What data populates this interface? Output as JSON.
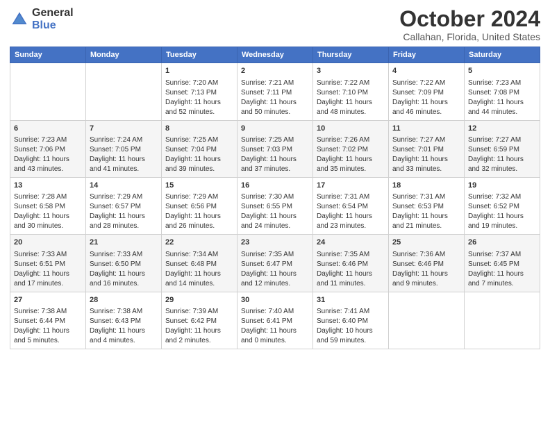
{
  "logo": {
    "general": "General",
    "blue": "Blue"
  },
  "title": "October 2024",
  "location": "Callahan, Florida, United States",
  "headers": [
    "Sunday",
    "Monday",
    "Tuesday",
    "Wednesday",
    "Thursday",
    "Friday",
    "Saturday"
  ],
  "weeks": [
    [
      {
        "day": "",
        "sunrise": "",
        "sunset": "",
        "daylight": ""
      },
      {
        "day": "",
        "sunrise": "",
        "sunset": "",
        "daylight": ""
      },
      {
        "day": "1",
        "sunrise": "Sunrise: 7:20 AM",
        "sunset": "Sunset: 7:13 PM",
        "daylight": "Daylight: 11 hours and 52 minutes."
      },
      {
        "day": "2",
        "sunrise": "Sunrise: 7:21 AM",
        "sunset": "Sunset: 7:11 PM",
        "daylight": "Daylight: 11 hours and 50 minutes."
      },
      {
        "day": "3",
        "sunrise": "Sunrise: 7:22 AM",
        "sunset": "Sunset: 7:10 PM",
        "daylight": "Daylight: 11 hours and 48 minutes."
      },
      {
        "day": "4",
        "sunrise": "Sunrise: 7:22 AM",
        "sunset": "Sunset: 7:09 PM",
        "daylight": "Daylight: 11 hours and 46 minutes."
      },
      {
        "day": "5",
        "sunrise": "Sunrise: 7:23 AM",
        "sunset": "Sunset: 7:08 PM",
        "daylight": "Daylight: 11 hours and 44 minutes."
      }
    ],
    [
      {
        "day": "6",
        "sunrise": "Sunrise: 7:23 AM",
        "sunset": "Sunset: 7:06 PM",
        "daylight": "Daylight: 11 hours and 43 minutes."
      },
      {
        "day": "7",
        "sunrise": "Sunrise: 7:24 AM",
        "sunset": "Sunset: 7:05 PM",
        "daylight": "Daylight: 11 hours and 41 minutes."
      },
      {
        "day": "8",
        "sunrise": "Sunrise: 7:25 AM",
        "sunset": "Sunset: 7:04 PM",
        "daylight": "Daylight: 11 hours and 39 minutes."
      },
      {
        "day": "9",
        "sunrise": "Sunrise: 7:25 AM",
        "sunset": "Sunset: 7:03 PM",
        "daylight": "Daylight: 11 hours and 37 minutes."
      },
      {
        "day": "10",
        "sunrise": "Sunrise: 7:26 AM",
        "sunset": "Sunset: 7:02 PM",
        "daylight": "Daylight: 11 hours and 35 minutes."
      },
      {
        "day": "11",
        "sunrise": "Sunrise: 7:27 AM",
        "sunset": "Sunset: 7:01 PM",
        "daylight": "Daylight: 11 hours and 33 minutes."
      },
      {
        "day": "12",
        "sunrise": "Sunrise: 7:27 AM",
        "sunset": "Sunset: 6:59 PM",
        "daylight": "Daylight: 11 hours and 32 minutes."
      }
    ],
    [
      {
        "day": "13",
        "sunrise": "Sunrise: 7:28 AM",
        "sunset": "Sunset: 6:58 PM",
        "daylight": "Daylight: 11 hours and 30 minutes."
      },
      {
        "day": "14",
        "sunrise": "Sunrise: 7:29 AM",
        "sunset": "Sunset: 6:57 PM",
        "daylight": "Daylight: 11 hours and 28 minutes."
      },
      {
        "day": "15",
        "sunrise": "Sunrise: 7:29 AM",
        "sunset": "Sunset: 6:56 PM",
        "daylight": "Daylight: 11 hours and 26 minutes."
      },
      {
        "day": "16",
        "sunrise": "Sunrise: 7:30 AM",
        "sunset": "Sunset: 6:55 PM",
        "daylight": "Daylight: 11 hours and 24 minutes."
      },
      {
        "day": "17",
        "sunrise": "Sunrise: 7:31 AM",
        "sunset": "Sunset: 6:54 PM",
        "daylight": "Daylight: 11 hours and 23 minutes."
      },
      {
        "day": "18",
        "sunrise": "Sunrise: 7:31 AM",
        "sunset": "Sunset: 6:53 PM",
        "daylight": "Daylight: 11 hours and 21 minutes."
      },
      {
        "day": "19",
        "sunrise": "Sunrise: 7:32 AM",
        "sunset": "Sunset: 6:52 PM",
        "daylight": "Daylight: 11 hours and 19 minutes."
      }
    ],
    [
      {
        "day": "20",
        "sunrise": "Sunrise: 7:33 AM",
        "sunset": "Sunset: 6:51 PM",
        "daylight": "Daylight: 11 hours and 17 minutes."
      },
      {
        "day": "21",
        "sunrise": "Sunrise: 7:33 AM",
        "sunset": "Sunset: 6:50 PM",
        "daylight": "Daylight: 11 hours and 16 minutes."
      },
      {
        "day": "22",
        "sunrise": "Sunrise: 7:34 AM",
        "sunset": "Sunset: 6:48 PM",
        "daylight": "Daylight: 11 hours and 14 minutes."
      },
      {
        "day": "23",
        "sunrise": "Sunrise: 7:35 AM",
        "sunset": "Sunset: 6:47 PM",
        "daylight": "Daylight: 11 hours and 12 minutes."
      },
      {
        "day": "24",
        "sunrise": "Sunrise: 7:35 AM",
        "sunset": "Sunset: 6:46 PM",
        "daylight": "Daylight: 11 hours and 11 minutes."
      },
      {
        "day": "25",
        "sunrise": "Sunrise: 7:36 AM",
        "sunset": "Sunset: 6:46 PM",
        "daylight": "Daylight: 11 hours and 9 minutes."
      },
      {
        "day": "26",
        "sunrise": "Sunrise: 7:37 AM",
        "sunset": "Sunset: 6:45 PM",
        "daylight": "Daylight: 11 hours and 7 minutes."
      }
    ],
    [
      {
        "day": "27",
        "sunrise": "Sunrise: 7:38 AM",
        "sunset": "Sunset: 6:44 PM",
        "daylight": "Daylight: 11 hours and 5 minutes."
      },
      {
        "day": "28",
        "sunrise": "Sunrise: 7:38 AM",
        "sunset": "Sunset: 6:43 PM",
        "daylight": "Daylight: 11 hours and 4 minutes."
      },
      {
        "day": "29",
        "sunrise": "Sunrise: 7:39 AM",
        "sunset": "Sunset: 6:42 PM",
        "daylight": "Daylight: 11 hours and 2 minutes."
      },
      {
        "day": "30",
        "sunrise": "Sunrise: 7:40 AM",
        "sunset": "Sunset: 6:41 PM",
        "daylight": "Daylight: 11 hours and 0 minutes."
      },
      {
        "day": "31",
        "sunrise": "Sunrise: 7:41 AM",
        "sunset": "Sunset: 6:40 PM",
        "daylight": "Daylight: 10 hours and 59 minutes."
      },
      {
        "day": "",
        "sunrise": "",
        "sunset": "",
        "daylight": ""
      },
      {
        "day": "",
        "sunrise": "",
        "sunset": "",
        "daylight": ""
      }
    ]
  ]
}
